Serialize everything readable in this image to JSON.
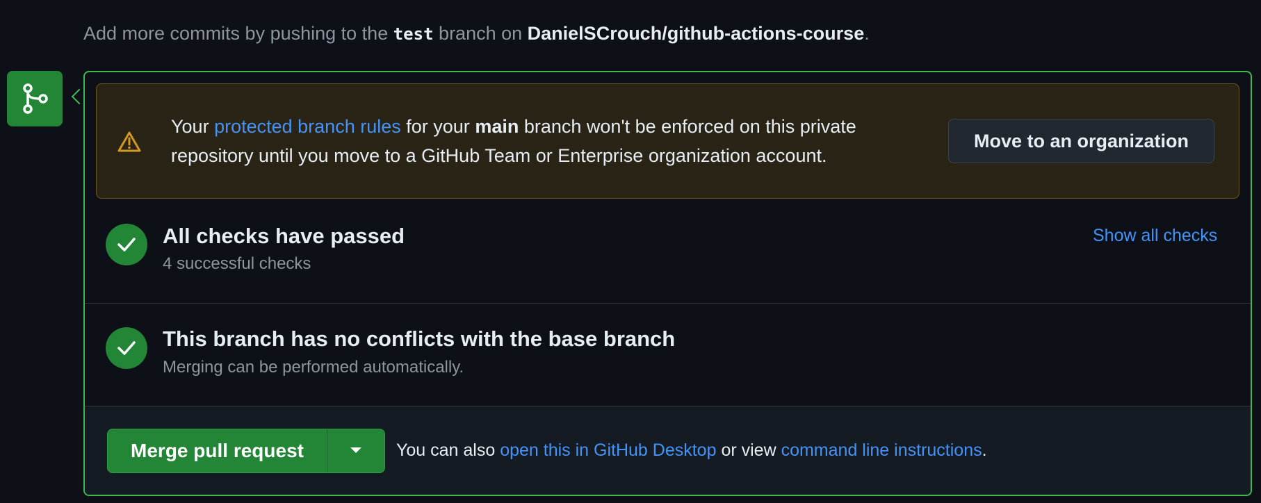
{
  "hint": {
    "prefix": "Add more commits by pushing to the",
    "branch": "test",
    "middle": "branch on",
    "repo": "DanielSCrouch/github-actions-course",
    "suffix": "."
  },
  "warning": {
    "t1": "Your",
    "link": "protected branch rules",
    "t2": "for your",
    "branch": "main",
    "t3": "branch won't be enforced on this private repository until you move to a GitHub Team or Enterprise organization account.",
    "button": "Move to an organization"
  },
  "checks": {
    "title": "All checks have passed",
    "subtitle": "4 successful checks",
    "show_all": "Show all checks"
  },
  "conflicts": {
    "title": "This branch has no conflicts with the base branch",
    "subtitle": "Merging can be performed automatically."
  },
  "footer": {
    "merge_button": "Merge pull request",
    "t1": "You can also",
    "desktop_link": "open this in GitHub Desktop",
    "t2": "or view",
    "cli_link": "command line instructions",
    "t3": "."
  },
  "colors": {
    "success": "#238636",
    "link": "#4493f8",
    "warning_icon": "#d29922"
  },
  "icons": {
    "branch": "git-merge-icon",
    "warning": "alert-icon",
    "check": "check-icon",
    "caret": "triangle-down-icon"
  }
}
